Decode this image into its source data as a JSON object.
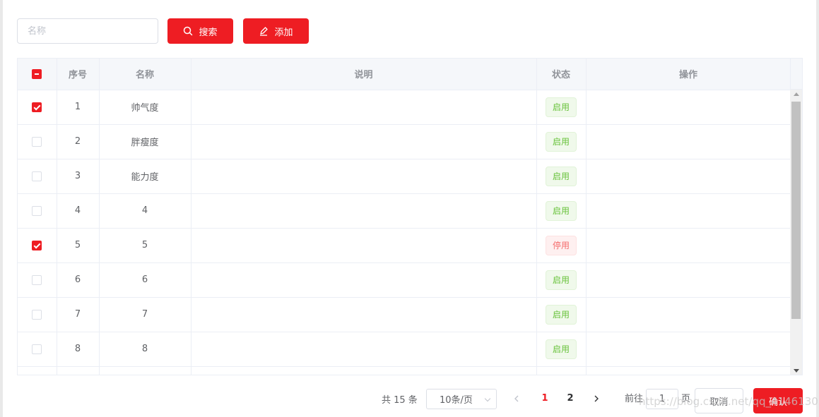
{
  "search": {
    "placeholder": "名称"
  },
  "toolbar": {
    "search_label": "搜索",
    "add_label": "添加"
  },
  "table": {
    "columns": [
      "",
      "序号",
      "名称",
      "说明",
      "状态",
      "操作"
    ],
    "rows": [
      {
        "checked": true,
        "index": "1",
        "name": "帅气度",
        "desc": "",
        "status": "启用",
        "enabled": true
      },
      {
        "checked": false,
        "index": "2",
        "name": "胖瘦度",
        "desc": "",
        "status": "启用",
        "enabled": true
      },
      {
        "checked": false,
        "index": "3",
        "name": "能力度",
        "desc": "",
        "status": "启用",
        "enabled": true
      },
      {
        "checked": false,
        "index": "4",
        "name": "4",
        "desc": "",
        "status": "启用",
        "enabled": true
      },
      {
        "checked": true,
        "index": "5",
        "name": "5",
        "desc": "",
        "status": "停用",
        "enabled": false
      },
      {
        "checked": false,
        "index": "6",
        "name": "6",
        "desc": "",
        "status": "启用",
        "enabled": true
      },
      {
        "checked": false,
        "index": "7",
        "name": "7",
        "desc": "",
        "status": "启用",
        "enabled": true
      },
      {
        "checked": false,
        "index": "8",
        "name": "8",
        "desc": "",
        "status": "启用",
        "enabled": true
      },
      {
        "checked": false,
        "index": "",
        "name": "",
        "desc": "",
        "status": "",
        "enabled": true
      }
    ]
  },
  "pagination": {
    "total_text": "共 15 条",
    "page_size": "10条/页",
    "pages": [
      "1",
      "2"
    ],
    "current_page": "1",
    "goto_label": "前往",
    "goto_value": "1",
    "page_suffix": "页"
  },
  "footer": {
    "cancel_label": "取消",
    "confirm_label": "确认"
  },
  "watermark": "https://blog.csdn.net/qq_41461303",
  "colors": {
    "accent": "#ee1d23",
    "enabled": "#67c23a",
    "disabled": "#f56c6c"
  }
}
